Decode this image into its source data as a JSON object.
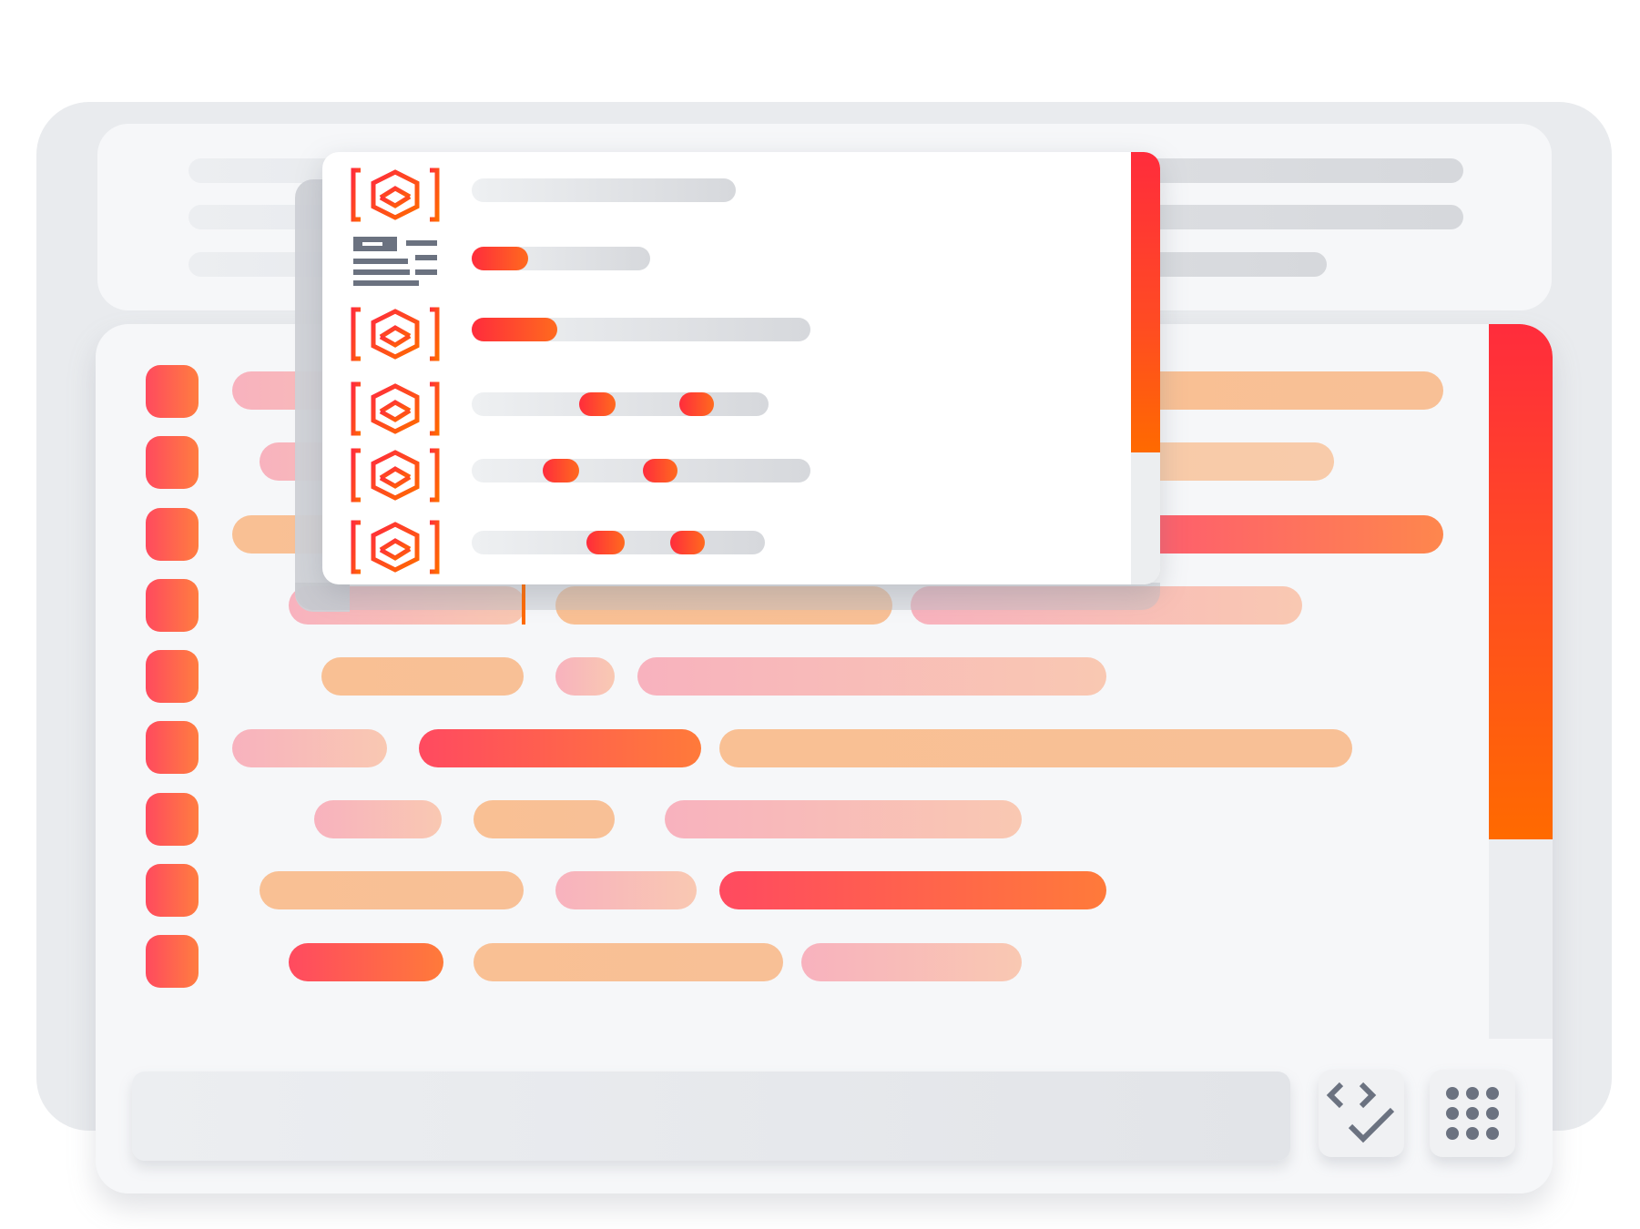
{
  "window": {
    "title": ""
  },
  "colors": {
    "accent_start": "#ff2c3c",
    "accent_end": "#ff6a00",
    "panel": "#f6f7f9",
    "icon_gray": "#6b7280"
  },
  "top_panel": {
    "lines": 3
  },
  "editor": {
    "rows": 9,
    "scrollbar_position": 0.0,
    "scrollbar_visible_fraction": 0.72
  },
  "autocomplete": {
    "items": [
      {
        "icon": "module-icon",
        "match": "none"
      },
      {
        "icon": "snippet-icon",
        "match": "prefix"
      },
      {
        "icon": "module-icon",
        "match": "prefix"
      },
      {
        "icon": "module-icon",
        "match": "fuzzy"
      },
      {
        "icon": "module-icon",
        "match": "fuzzy"
      },
      {
        "icon": "module-icon",
        "match": "fuzzy"
      }
    ],
    "scrollbar_visible_fraction": 0.69
  },
  "bottom_bar": {
    "command_input": {
      "value": "",
      "placeholder": ""
    },
    "buttons": [
      {
        "name": "validate-button",
        "icon": "code-check-icon"
      },
      {
        "name": "apps-button",
        "icon": "grid-dots-icon"
      }
    ]
  }
}
